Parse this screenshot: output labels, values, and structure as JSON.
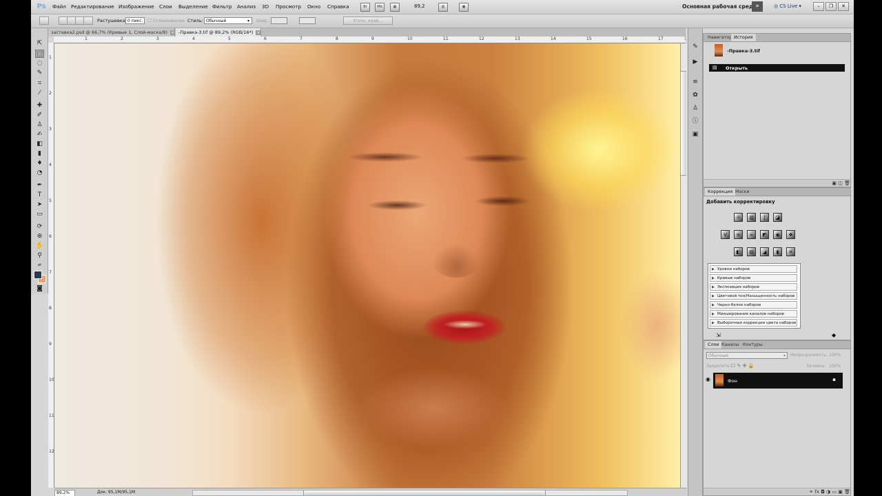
{
  "menubar": {
    "logo": "Ps",
    "menus": [
      "Файл",
      "Редактирование",
      "Изображение",
      "Слои",
      "Выделение",
      "Фильтр",
      "Анализ",
      "3D",
      "Просмотр",
      "Окно",
      "Справка"
    ],
    "icons": {
      "br": "Br",
      "mb": "Mb"
    },
    "zoom": "89,2",
    "workspace": "Основная рабочая среда",
    "workspace_more": "»",
    "cs_live": "CS Live"
  },
  "options": {
    "feather_label": "Растушевка:",
    "feather_value": "0 пикс.",
    "antialias_label": "Сглаживание",
    "style_label": "Стиль:",
    "style_value": "Обычный",
    "width_label": "Шир.:",
    "height_label": "Выс.:",
    "refine_edge_button": "Уточн. край..."
  },
  "tabs": [
    {
      "label": "заставка2.psd @ 66,7% (Кривые 1, Слой-маска/8)",
      "active": false
    },
    {
      "label": "-Правка-3.tif @ 89,2% (RGB/16*)",
      "active": true
    }
  ],
  "ruler": {
    "top": [
      "1",
      "2",
      "3",
      "4",
      "5",
      "6",
      "7",
      "8",
      "9",
      "10",
      "11",
      "12",
      "13",
      "14",
      "15",
      "16",
      "17",
      "18"
    ],
    "left": [
      "1",
      "2",
      "3",
      "4",
      "5",
      "6",
      "7",
      "8",
      "9",
      "10",
      "11",
      "12"
    ]
  },
  "colors": {
    "foreground": "#283a55",
    "background": "#f2a070"
  },
  "status": {
    "zoom": "89,2%",
    "doc_size": "Док: 95,1M/95,1M"
  },
  "history_panel": {
    "tabs": [
      "Навигатор",
      "История"
    ],
    "snapshot": "-Правка-3.tif",
    "step": "Открыть"
  },
  "adjustments_panel": {
    "tabs": [
      "Коррекция",
      "Маски"
    ],
    "title": "Добавить корректировку",
    "presets": [
      "Уровни наборов",
      "Кривые наборов",
      "Экспозиция наборов",
      "Цветовой тон/Насыщенность наборов",
      "Черно-белое наборов",
      "Микширование каналов наборов",
      "Выборочная коррекция цвета наборов"
    ]
  },
  "layers_panel": {
    "tabs": [
      "Слои",
      "Каналы",
      "Контуры"
    ],
    "blend_mode": "Обычные",
    "opacity_label": "Непрозрачность:",
    "opacity_value": "100%",
    "lock_label": "Закрепить:",
    "fill_label": "Заливка:",
    "fill_value": "100%",
    "layer_name": "Фон"
  }
}
